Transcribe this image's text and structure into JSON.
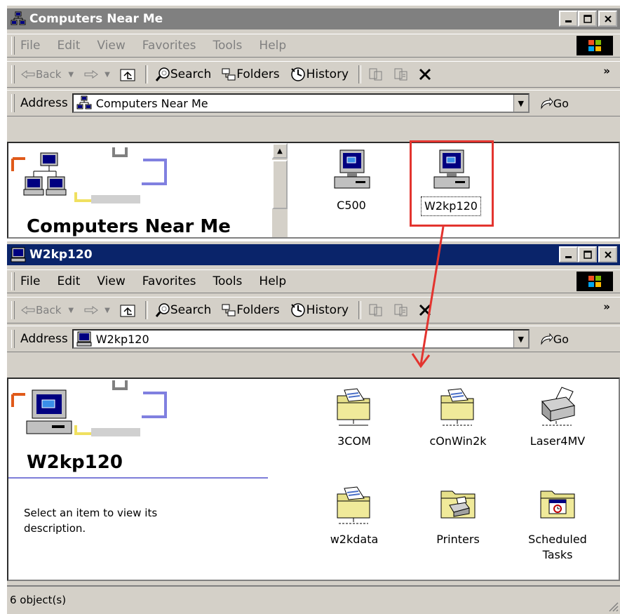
{
  "colors": {
    "inactive_title": "#808080",
    "active_title": "#0a246a",
    "annotation": "#e3342f"
  },
  "win1": {
    "title": "Computers Near Me",
    "menu": [
      "File",
      "Edit",
      "View",
      "Favorites",
      "Tools",
      "Help"
    ],
    "toolbar": {
      "back": "Back",
      "search": "Search",
      "folders": "Folders",
      "history": "History"
    },
    "address_label": "Address",
    "address_value": "Computers Near Me",
    "go": "Go",
    "heading": "Computers Near Me",
    "items": [
      {
        "label": "C500",
        "icon": "computer-icon"
      },
      {
        "label": "W2kp120",
        "icon": "computer-icon"
      }
    ]
  },
  "win2": {
    "title": "W2kp120",
    "menu": [
      "File",
      "Edit",
      "View",
      "Favorites",
      "Tools",
      "Help"
    ],
    "toolbar": {
      "back": "Back",
      "search": "Search",
      "folders": "Folders",
      "history": "History"
    },
    "address_label": "Address",
    "address_value": "W2kp120",
    "go": "Go",
    "heading": "W2kp120",
    "description": "Select an item to view its description.",
    "items": [
      {
        "label": "3COM",
        "icon": "shared-folder-icon"
      },
      {
        "label": "cOnWin2k",
        "icon": "shared-folder-icon"
      },
      {
        "label": "Laser4MV",
        "icon": "network-printer-icon"
      },
      {
        "label": "w2kdata",
        "icon": "shared-folder-icon"
      },
      {
        "label": "Printers",
        "icon": "printers-folder-icon"
      },
      {
        "label": "Scheduled Tasks",
        "icon": "scheduled-tasks-icon"
      }
    ],
    "status": "6 object(s)"
  }
}
